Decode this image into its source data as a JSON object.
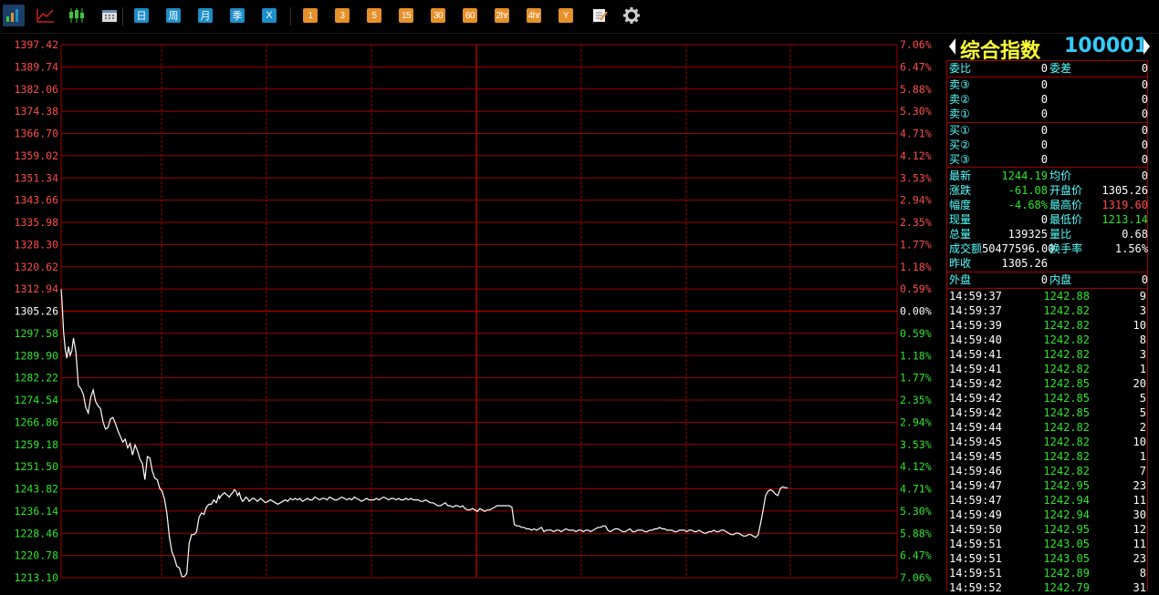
{
  "toolbar": {
    "periods": [
      "日",
      "周",
      "月",
      "季",
      "X"
    ],
    "minutes": [
      "1",
      "3",
      "5",
      "15",
      "30",
      "60",
      "2hr",
      "4hr",
      "Y"
    ]
  },
  "colors": {
    "up": "#ff4a4a",
    "down": "#2ee32e",
    "grid": "#a00000",
    "label": "#55ffff",
    "title": "#ffff33",
    "code": "#33ccff"
  },
  "chart_data": {
    "type": "line",
    "prev_close": 1305.26,
    "left_ticks": [
      "1397.42",
      "1389.74",
      "1382.06",
      "1374.38",
      "1366.70",
      "1359.02",
      "1351.34",
      "1343.66",
      "1335.98",
      "1328.30",
      "1320.62",
      "1312.94",
      "1305.26",
      "1297.58",
      "1289.90",
      "1282.22",
      "1274.54",
      "1266.86",
      "1259.18",
      "1251.50",
      "1243.82",
      "1236.14",
      "1228.46",
      "1220.78",
      "1213.10"
    ],
    "right_ticks": [
      "7.06%",
      "6.47%",
      "5.88%",
      "5.30%",
      "4.71%",
      "4.12%",
      "3.53%",
      "2.94%",
      "2.35%",
      "1.77%",
      "1.18%",
      "0.59%",
      "0.00%",
      "0.59%",
      "1.18%",
      "1.77%",
      "2.35%",
      "2.94%",
      "3.53%",
      "4.12%",
      "4.71%",
      "5.30%",
      "5.88%",
      "6.47%",
      "7.06%"
    ],
    "ylim": [
      1213.1,
      1397.42
    ],
    "x": [
      0,
      1,
      3,
      5,
      7,
      9,
      11,
      13,
      15,
      18,
      21,
      24,
      27,
      30,
      33,
      36,
      39,
      42,
      45,
      48,
      51,
      54,
      57,
      60,
      63,
      66,
      69,
      72,
      75,
      78,
      81,
      84,
      87,
      90,
      93,
      96,
      99,
      102,
      105,
      108,
      111,
      114,
      117,
      120,
      123,
      126,
      129,
      132,
      135,
      138,
      141,
      144,
      147,
      150,
      153,
      156,
      159,
      162,
      165,
      168,
      171,
      174,
      177,
      180,
      183,
      186,
      189,
      192,
      193,
      195,
      197,
      199,
      201,
      203,
      205,
      207,
      209,
      211,
      213,
      215,
      217,
      219,
      221,
      223,
      225,
      227,
      229,
      231,
      233,
      235,
      237,
      239,
      241,
      243,
      245,
      247,
      249,
      252,
      255,
      258,
      261,
      264,
      267,
      270,
      273,
      276,
      279,
      282,
      285,
      288,
      291,
      294,
      297,
      300,
      303,
      306,
      309,
      312,
      315,
      318,
      321,
      324,
      327,
      330,
      333,
      336,
      339,
      342,
      345,
      348,
      351,
      354,
      357,
      360,
      363,
      366,
      369,
      372,
      375,
      378,
      381,
      384,
      387,
      390,
      393,
      396,
      399,
      402,
      405,
      408,
      411,
      414,
      417,
      420,
      423,
      426,
      429,
      432,
      435,
      438,
      441,
      444,
      447,
      450,
      453,
      456,
      459,
      462,
      465,
      468,
      471,
      474,
      477,
      480,
      483,
      486,
      489,
      492,
      495,
      498,
      501,
      504,
      507,
      510,
      513,
      516,
      519,
      522,
      525,
      528,
      531,
      534,
      537,
      540,
      543,
      546,
      549,
      552,
      555,
      558,
      561,
      564,
      567,
      570,
      573,
      576,
      579,
      582,
      585,
      588,
      591,
      594,
      597,
      600,
      603,
      606,
      609,
      612,
      615,
      618,
      621,
      624,
      627,
      630,
      633,
      636,
      639,
      642,
      645,
      648,
      651,
      654,
      657,
      660,
      663,
      666,
      669,
      672,
      675,
      678,
      681,
      684,
      687,
      690,
      693,
      696,
      699,
      702,
      705,
      708,
      711,
      714,
      717,
      720,
      723,
      726,
      729,
      732,
      735,
      738,
      741,
      744,
      747,
      750,
      753,
      756,
      759,
      762,
      765,
      768,
      771,
      774,
      777,
      780,
      783,
      786,
      789,
      792,
      795,
      798,
      801,
      804,
      807,
      810,
      813,
      816,
      819,
      822,
      825,
      828,
      831,
      834,
      837,
      840,
      843,
      846,
      849,
      852,
      855,
      858,
      861,
      864,
      867,
      870,
      873,
      876,
      879,
      882,
      885,
      888,
      891,
      894,
      897,
      900,
      903,
      906,
      909,
      912,
      915,
      918,
      921,
      924,
      927,
      930,
      933,
      936,
      939,
      942,
      945,
      948,
      951,
      954,
      957,
      960,
      962,
      965,
      968,
      971,
      974,
      977,
      980,
      983,
      986,
      989,
      992,
      995,
      998,
      1001,
      1004,
      1007,
      1010,
      1013,
      1016
    ],
    "values": [
      1312.9,
      1309.0,
      1298.0,
      1292.0,
      1289.0,
      1293.0,
      1290.0,
      1291.5,
      1296.0,
      1291.0,
      1279.5,
      1278.5,
      1276.5,
      1272.0,
      1270.0,
      1275.5,
      1278.0,
      1274.0,
      1272.5,
      1271.5,
      1267.0,
      1264.5,
      1265.0,
      1268.0,
      1268.5,
      1266.5,
      1264.0,
      1262.0,
      1260.0,
      1261.0,
      1258.0,
      1259.5,
      1255.5,
      1259.0,
      1257.0,
      1254.0,
      1252.5,
      1247.0,
      1255.0,
      1254.5,
      1250.0,
      1247.5,
      1247.0,
      1244.0,
      1243.0,
      1240.0,
      1235.0,
      1227.0,
      1222.0,
      1220.0,
      1217.0,
      1216.5,
      1213.5,
      1213.5,
      1214.5,
      1225.0,
      1228.0,
      1228.0,
      1229.0,
      1234.0,
      1235.5,
      1235.0,
      1237.5,
      1238.5,
      1238.5,
      1240.0,
      1239.0,
      1241.5,
      1240.5,
      1241.5,
      1242.0,
      1242.5,
      1242.0,
      1241.5,
      1241.0,
      1242.0,
      1242.5,
      1243.5,
      1243.0,
      1241.5,
      1242.5,
      1240.5,
      1239.5,
      1240.0,
      1241.0,
      1240.5,
      1239.5,
      1240.0,
      1240.5,
      1240.5,
      1240.0,
      1239.5,
      1240.0,
      1240.5,
      1240.0,
      1239.5,
      1239.0,
      1239.5,
      1240.0,
      1239.5,
      1239.0,
      1238.5,
      1239.0,
      1239.5,
      1240.0,
      1239.5,
      1240.5,
      1240.0,
      1240.5,
      1240.0,
      1240.5,
      1239.5,
      1240.0,
      1240.5,
      1240.0,
      1240.0,
      1241.0,
      1240.5,
      1240.0,
      1240.5,
      1240.5,
      1240.0,
      1241.0,
      1240.5,
      1240.0,
      1240.0,
      1240.5,
      1241.0,
      1240.5,
      1240.0,
      1240.5,
      1240.0,
      1241.0,
      1240.5,
      1240.0,
      1239.5,
      1240.0,
      1240.5,
      1240.0,
      1240.0,
      1240.0,
      1240.5,
      1240.0,
      1240.5,
      1241.0,
      1240.5,
      1240.0,
      1240.5,
      1240.5,
      1240.0,
      1240.5,
      1240.0,
      1240.0,
      1240.5,
      1240.0,
      1240.5,
      1240.0,
      1240.0,
      1240.0,
      1239.5,
      1239.5,
      1240.0,
      1239.5,
      1239.0,
      1239.0,
      1238.5,
      1238.0,
      1238.0,
      1238.5,
      1239.0,
      1238.0,
      1238.0,
      1237.5,
      1238.0,
      1238.0,
      1237.5,
      1238.0,
      1237.0,
      1236.5,
      1236.5,
      1237.0,
      1236.5,
      1236.0,
      1237.0,
      1236.5,
      1236.0,
      1236.5,
      1236.5,
      1237.0,
      1237.5,
      1238.0,
      1238.0,
      1238.0,
      1238.0,
      1238.0,
      1238.0,
      1237.5,
      1231.5,
      1231.0,
      1231.0,
      1230.5,
      1230.5,
      1230.0,
      1230.0,
      1229.5,
      1230.0,
      1229.5,
      1230.0,
      1230.5,
      1229.0,
      1229.5,
      1229.5,
      1229.5,
      1229.0,
      1229.5,
      1229.5,
      1229.0,
      1229.5,
      1230.0,
      1229.5,
      1229.5,
      1229.5,
      1229.0,
      1229.5,
      1229.5,
      1229.0,
      1229.5,
      1229.5,
      1229.0,
      1229.5,
      1230.0,
      1230.5,
      1230.5,
      1231.0,
      1231.0,
      1229.5,
      1229.0,
      1229.5,
      1230.0,
      1230.0,
      1229.5,
      1229.0,
      1229.0,
      1229.5,
      1230.0,
      1229.0,
      1229.0,
      1229.5,
      1229.5,
      1229.5,
      1229.0,
      1229.0,
      1229.5,
      1229.5,
      1230.0,
      1230.0,
      1230.5,
      1230.0,
      1230.0,
      1229.5,
      1229.5,
      1229.5,
      1229.0,
      1229.0,
      1229.5,
      1229.5,
      1229.5,
      1229.0,
      1229.5,
      1229.5,
      1229.0,
      1229.0,
      1229.5,
      1229.0,
      1228.5,
      1228.5,
      1229.0,
      1229.0,
      1229.5,
      1229.0,
      1229.0,
      1229.5,
      1229.5,
      1229.0,
      1228.5,
      1228.0,
      1228.0,
      1228.5,
      1228.5,
      1228.0,
      1227.5,
      1227.5,
      1228.0,
      1228.0,
      1227.5,
      1227.0,
      1228.0,
      1232.0,
      1236.5,
      1241.5,
      1243.0,
      1243.5,
      1243.0,
      1242.0,
      1241.5,
      1244.0,
      1244.5,
      1244.2,
      1244.2
    ]
  },
  "panel": {
    "title": "综合指数",
    "code": "100001",
    "weibi_label": "委比",
    "weibi_val": "0",
    "weicha_label": "委差",
    "weicha_val": "0",
    "sells": [
      {
        "label": "卖③",
        "p": "0",
        "v": "0"
      },
      {
        "label": "卖②",
        "p": "0",
        "v": "0"
      },
      {
        "label": "卖①",
        "p": "0",
        "v": "0"
      }
    ],
    "buys": [
      {
        "label": "买①",
        "p": "0",
        "v": "0"
      },
      {
        "label": "买②",
        "p": "0",
        "v": "0"
      },
      {
        "label": "买③",
        "p": "0",
        "v": "0"
      }
    ],
    "stats": [
      {
        "l1": "最新",
        "v1": "1244.19",
        "c1": "#2ee32e",
        "l2": "均价",
        "v2": "0",
        "c2": "#ffffff"
      },
      {
        "l1": "涨跌",
        "v1": "-61.08",
        "c1": "#2ee32e",
        "l2": "开盘价",
        "v2": "1305.26",
        "c2": "#ffffff"
      },
      {
        "l1": "幅度",
        "v1": "-4.68%",
        "c1": "#2ee32e",
        "l2": "最高价",
        "v2": "1319.60",
        "c2": "#ff4a4a"
      },
      {
        "l1": "现量",
        "v1": "0",
        "c1": "#ffffff",
        "l2": "最低价",
        "v2": "1213.14",
        "c2": "#2ee32e"
      },
      {
        "l1": "总量",
        "v1": "139325",
        "c1": "#ffffff",
        "l2": "量比",
        "v2": "0.68",
        "c2": "#ffffff"
      },
      {
        "l1": "成交额",
        "v1": "50477596.00",
        "c1": "#ffffff",
        "l2": "换手率",
        "v2": "1.56%",
        "c2": "#ffffff"
      },
      {
        "l1": "昨收",
        "v1": "1305.26",
        "c1": "#ffffff",
        "l2": "",
        "v2": "",
        "c2": "#ffffff"
      }
    ],
    "waipan_label": "外盘",
    "waipan_val": "0",
    "neipan_label": "内盘",
    "neipan_val": "0",
    "ticks": [
      {
        "t": "14:59:37",
        "p": "1242.88",
        "v": "9"
      },
      {
        "t": "14:59:37",
        "p": "1242.82",
        "v": "3"
      },
      {
        "t": "14:59:39",
        "p": "1242.82",
        "v": "10"
      },
      {
        "t": "14:59:40",
        "p": "1242.82",
        "v": "8"
      },
      {
        "t": "14:59:41",
        "p": "1242.82",
        "v": "3"
      },
      {
        "t": "14:59:41",
        "p": "1242.82",
        "v": "1"
      },
      {
        "t": "14:59:42",
        "p": "1242.85",
        "v": "20"
      },
      {
        "t": "14:59:42",
        "p": "1242.85",
        "v": "5"
      },
      {
        "t": "14:59:42",
        "p": "1242.85",
        "v": "5"
      },
      {
        "t": "14:59:44",
        "p": "1242.82",
        "v": "2"
      },
      {
        "t": "14:59:45",
        "p": "1242.82",
        "v": "10"
      },
      {
        "t": "14:59:45",
        "p": "1242.82",
        "v": "1"
      },
      {
        "t": "14:59:46",
        "p": "1242.82",
        "v": "7"
      },
      {
        "t": "14:59:47",
        "p": "1242.95",
        "v": "23"
      },
      {
        "t": "14:59:47",
        "p": "1242.94",
        "v": "11"
      },
      {
        "t": "14:59:49",
        "p": "1242.94",
        "v": "30"
      },
      {
        "t": "14:59:50",
        "p": "1242.95",
        "v": "12"
      },
      {
        "t": "14:59:51",
        "p": "1243.05",
        "v": "11"
      },
      {
        "t": "14:59:51",
        "p": "1243.05",
        "v": "23"
      },
      {
        "t": "14:59:51",
        "p": "1242.89",
        "v": "8"
      },
      {
        "t": "14:59:52",
        "p": "1242.79",
        "v": "31"
      }
    ]
  }
}
